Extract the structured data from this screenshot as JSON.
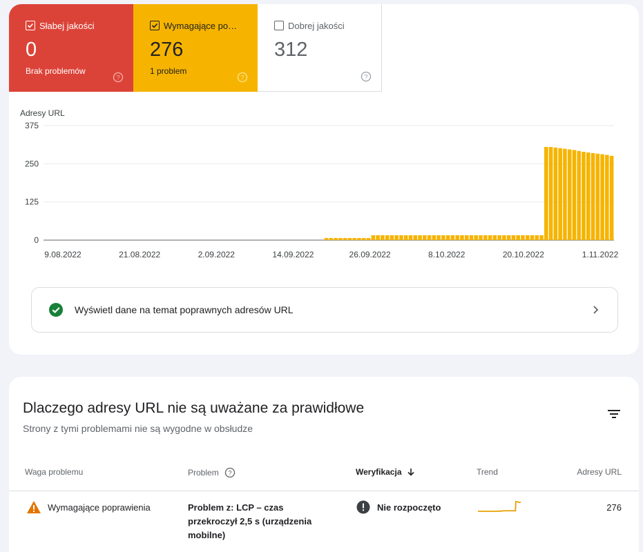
{
  "tiles": {
    "poor": {
      "label": "Słabej jakości",
      "count": "0",
      "sub": "Brak problemów",
      "checked": true
    },
    "needs_improvement": {
      "label": "Wymagające poprawienia",
      "count": "276",
      "sub": "1 problem",
      "checked": true
    },
    "good": {
      "label": "Dobrej jakości",
      "count": "312",
      "sub": "",
      "checked": false
    }
  },
  "colors": {
    "poor": "#dc4338",
    "needs_improvement": "#f6b400",
    "good_check": "#188038",
    "grid": "#e8eaed"
  },
  "chart_data": {
    "type": "bar",
    "ylabel": "Adresy URL",
    "ylim": [
      0,
      375
    ],
    "yticks": [
      "0",
      "125",
      "250",
      "375"
    ],
    "xticks": [
      "9.08.2022",
      "21.08.2022",
      "2.09.2022",
      "14.09.2022",
      "26.09.2022",
      "8.10.2022",
      "20.10.2022",
      "1.11.2022"
    ],
    "series": [
      {
        "color": "#f6b400",
        "values": [
          0,
          0,
          0,
          0,
          0,
          0,
          0,
          0,
          0,
          0,
          0,
          0,
          0,
          0,
          0,
          0,
          0,
          0,
          0,
          0,
          0,
          0,
          0,
          0,
          0,
          0,
          0,
          0,
          0,
          0,
          0,
          0,
          0,
          0,
          0,
          0,
          0,
          0,
          0,
          0,
          0,
          0,
          0,
          0,
          0,
          0,
          0,
          0,
          0,
          0,
          0,
          0,
          0,
          0,
          0,
          0,
          0,
          0,
          0,
          0,
          7,
          7,
          7,
          7,
          7,
          7,
          7,
          7,
          7,
          7,
          16,
          16,
          16,
          16,
          16,
          16,
          16,
          16,
          16,
          16,
          16,
          16,
          16,
          16,
          16,
          16,
          16,
          16,
          16,
          16,
          16,
          16,
          16,
          16,
          16,
          16,
          16,
          16,
          16,
          16,
          16,
          16,
          16,
          16,
          16,
          16,
          16,
          305,
          305,
          303,
          301,
          299,
          297,
          295,
          292,
          289,
          287,
          285,
          283,
          281,
          279,
          276
        ]
      }
    ]
  },
  "good_link": {
    "text": "Wyświetl dane na temat poprawnych adresów URL"
  },
  "issues": {
    "title": "Dlaczego adresy URL nie są uważane za prawidłowe",
    "subtitle": "Strony z tymi problemami nie są wygodne w obsłudze",
    "columns": {
      "severity": "Waga problemu",
      "problem": "Problem",
      "validation": "Weryfikacja",
      "trend": "Trend",
      "urls": "Adresy URL"
    },
    "rows": [
      {
        "severity": "Wymagające poprawienia",
        "problem": "Problem z: LCP – czas przekroczył 2,5 s (urządzenia mobilne)",
        "validation": "Nie rozpoczęto",
        "urls": "276"
      }
    ]
  }
}
